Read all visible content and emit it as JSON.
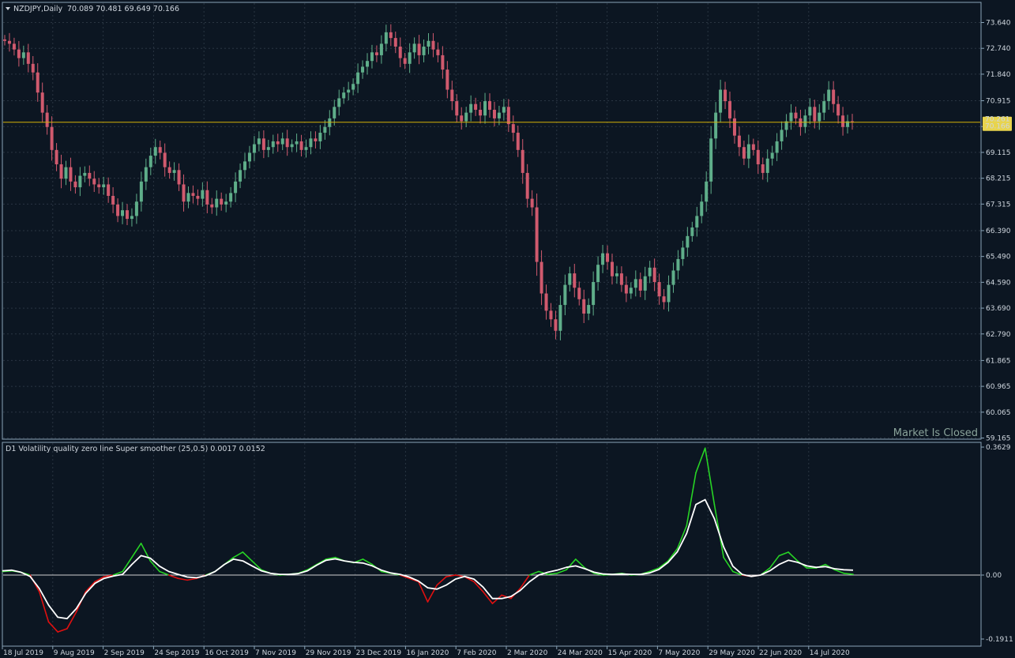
{
  "colors": {
    "background": "#0c1622",
    "grid": "#2a3542",
    "frame": "#8aa4b8",
    "text": "#cfd6de",
    "bull_candle": "#5fae8a",
    "bear_candle": "#d05a6e",
    "price_line": "#d4b106",
    "price_tag_bg": "#e8d44d",
    "vq_positive": "#27d325",
    "vq_negative": "#e01010",
    "vq_smooth": "#ffffff",
    "zero_line": "#d0d0d0"
  },
  "header": {
    "symbol_label": "NZDJPY,Daily",
    "ohlc": "70.089 70.481 69.649 70.166"
  },
  "indicator": {
    "label": "D1 Volatility quality zero line Super smoother (25,0.5) 0.0017 0.0152"
  },
  "status": {
    "market_text": "Market Is Closed"
  },
  "chart_data": [
    {
      "type": "candlestick",
      "title": "NZDJPY,Daily",
      "price_axis_ticks": [
        "73.640",
        "72.740",
        "71.840",
        "70.915",
        "70.015",
        "69.115",
        "68.215",
        "67.315",
        "66.390",
        "65.490",
        "64.590",
        "63.690",
        "62.790",
        "61.865",
        "60.965",
        "60.065",
        "59.165"
      ],
      "current_price_labels": [
        "70.261",
        "70.166"
      ],
      "current_price": 70.166,
      "time_axis_labels": [
        "18 Jul 2019",
        "9 Aug 2019",
        "2 Sep 2019",
        "24 Sep 2019",
        "16 Oct 2019",
        "7 Nov 2019",
        "29 Nov 2019",
        "23 Dec 2019",
        "16 Jan 2020",
        "7 Feb 2020",
        "2 Mar 2020",
        "24 Mar 2020",
        "15 Apr 2020",
        "7 May 2020",
        "29 May 2020",
        "22 Jun 2020",
        "14 Jul 2020"
      ],
      "ylim": [
        59.165,
        74.0
      ],
      "close_path": [
        73.0,
        72.9,
        72.7,
        72.4,
        72.6,
        72.2,
        71.9,
        71.2,
        70.5,
        70.0,
        69.2,
        68.7,
        68.2,
        68.6,
        68.1,
        67.9,
        68.3,
        68.4,
        68.2,
        68.0,
        67.9,
        68.0,
        67.6,
        67.3,
        66.9,
        67.1,
        66.8,
        66.9,
        67.4,
        68.1,
        68.6,
        69.0,
        69.3,
        69.1,
        68.6,
        68.4,
        68.5,
        68.0,
        67.4,
        67.7,
        67.6,
        67.5,
        67.8,
        67.3,
        67.2,
        67.5,
        67.3,
        67.4,
        67.7,
        68.1,
        68.5,
        68.8,
        69.1,
        69.4,
        69.6,
        69.2,
        69.3,
        69.5,
        69.4,
        69.6,
        69.3,
        69.4,
        69.5,
        69.2,
        69.3,
        69.6,
        69.5,
        69.8,
        70.0,
        70.3,
        70.7,
        71.0,
        71.2,
        71.3,
        71.5,
        71.9,
        72.1,
        72.3,
        72.6,
        72.5,
        72.9,
        73.3,
        73.1,
        72.8,
        72.4,
        72.2,
        72.6,
        72.9,
        72.5,
        72.8,
        73.0,
        72.7,
        72.5,
        72.0,
        71.3,
        70.9,
        70.4,
        70.2,
        70.5,
        70.8,
        70.6,
        70.4,
        70.9,
        70.6,
        70.3,
        70.5,
        70.7,
        70.1,
        69.8,
        69.2,
        68.4,
        67.5,
        67.2,
        65.3,
        64.2,
        63.6,
        63.3,
        62.9,
        63.8,
        64.5,
        64.9,
        64.4,
        64.0,
        63.5,
        63.8,
        64.6,
        65.2,
        65.6,
        65.3,
        64.8,
        64.9,
        64.5,
        64.2,
        64.4,
        64.7,
        64.3,
        64.8,
        65.1,
        64.6,
        64.1,
        63.9,
        64.5,
        65.0,
        65.4,
        65.8,
        66.2,
        66.5,
        66.9,
        67.4,
        68.1,
        69.6,
        70.5,
        71.3,
        70.9,
        70.3,
        69.7,
        69.3,
        68.9,
        69.4,
        69.2,
        68.7,
        68.4,
        68.9,
        69.1,
        69.5,
        69.9,
        70.2,
        70.5,
        70.3,
        70.0,
        70.4,
        70.7,
        70.2,
        70.5,
        70.9,
        71.3,
        70.8,
        70.4,
        70.0,
        70.2,
        70.166
      ]
    },
    {
      "type": "line",
      "title": "D1 Volatility quality zero line Super smoother (25,0.5)",
      "ylim": [
        -0.1911,
        0.3629
      ],
      "axis_ticks": [
        "0.3629",
        "0.00",
        "-0.1911"
      ],
      "series": [
        {
          "values": [
            0.01,
            0.012,
            0.008,
            0.0,
            -0.05,
            -0.14,
            -0.17,
            -0.16,
            -0.11,
            -0.05,
            -0.02,
            -0.005,
            0.0,
            0.01,
            0.05,
            0.09,
            0.04,
            0.01,
            0.0,
            -0.01,
            -0.015,
            -0.01,
            0.0,
            0.01,
            0.03,
            0.05,
            0.065,
            0.04,
            0.015,
            0.005,
            0.0,
            0.002,
            0.005,
            0.015,
            0.03,
            0.045,
            0.05,
            0.04,
            0.035,
            0.045,
            0.03,
            0.01,
            0.005,
            0.0,
            -0.01,
            -0.02,
            -0.08,
            -0.03,
            -0.005,
            0.0,
            -0.005,
            -0.02,
            -0.05,
            -0.085,
            -0.06,
            -0.07,
            -0.04,
            0.0,
            0.01,
            0.002,
            0.005,
            0.015,
            0.045,
            0.02,
            0.005,
            0.0,
            0.002,
            0.005,
            0.0,
            0.002,
            0.01,
            0.02,
            0.04,
            0.075,
            0.14,
            0.29,
            0.36,
            0.2,
            0.05,
            0.01,
            0.0,
            -0.004,
            0.0,
            0.02,
            0.055,
            0.065,
            0.04,
            0.02,
            0.02,
            0.03,
            0.015,
            0.005,
            0.002
          ]
        },
        {
          "values": [
            0.012,
            0.014,
            0.008,
            -0.004,
            -0.04,
            -0.09,
            -0.126,
            -0.13,
            -0.1,
            -0.055,
            -0.025,
            -0.01,
            -0.003,
            0.002,
            0.03,
            0.055,
            0.048,
            0.025,
            0.01,
            0.002,
            -0.006,
            -0.008,
            -0.002,
            0.01,
            0.03,
            0.045,
            0.04,
            0.026,
            0.012,
            0.005,
            0.002,
            0.002,
            0.004,
            0.012,
            0.028,
            0.042,
            0.046,
            0.04,
            0.036,
            0.034,
            0.026,
            0.014,
            0.006,
            0.002,
            -0.006,
            -0.018,
            -0.038,
            -0.042,
            -0.03,
            -0.012,
            -0.004,
            -0.012,
            -0.036,
            -0.07,
            -0.07,
            -0.064,
            -0.046,
            -0.02,
            0.0,
            0.008,
            0.014,
            0.022,
            0.026,
            0.018,
            0.008,
            0.003,
            0.002,
            0.003,
            0.002,
            0.002,
            0.006,
            0.016,
            0.036,
            0.066,
            0.118,
            0.2,
            0.214,
            0.16,
            0.08,
            0.025,
            0.002,
            -0.004,
            0.0,
            0.012,
            0.03,
            0.042,
            0.036,
            0.026,
            0.022,
            0.024,
            0.018,
            0.015,
            0.014
          ]
        }
      ]
    }
  ]
}
